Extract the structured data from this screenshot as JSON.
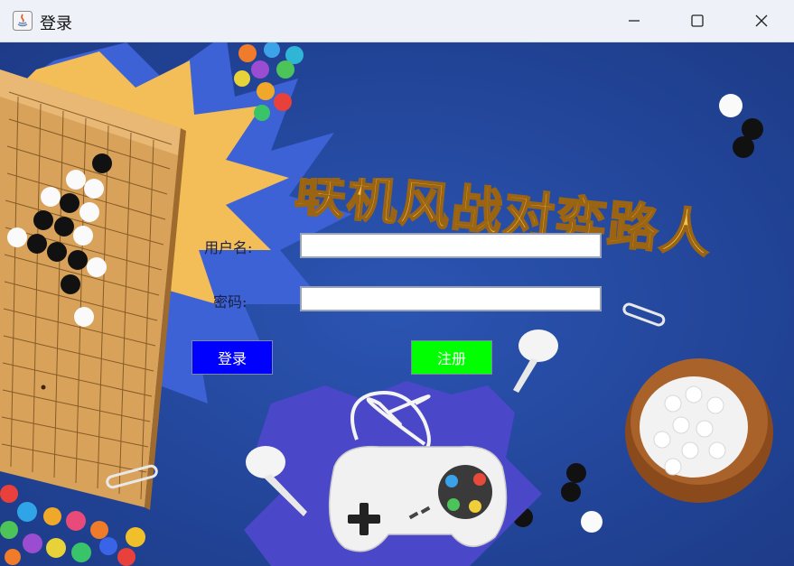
{
  "window": {
    "title": "登录",
    "icons": [
      "java-app-icon",
      "minimize-icon",
      "maximize-icon",
      "close-icon"
    ]
  },
  "banner": {
    "title": "联机风战对弈路人"
  },
  "form": {
    "username_label": "用户名:",
    "username_value": "",
    "password_label": "密码:",
    "password_value": ""
  },
  "buttons": {
    "login_label": "登录",
    "register_label": "注册"
  },
  "colors": {
    "background": "#23469a",
    "login_button": "#0000ff",
    "register_button": "#00ff00",
    "title_gold": "#f2c14e"
  }
}
